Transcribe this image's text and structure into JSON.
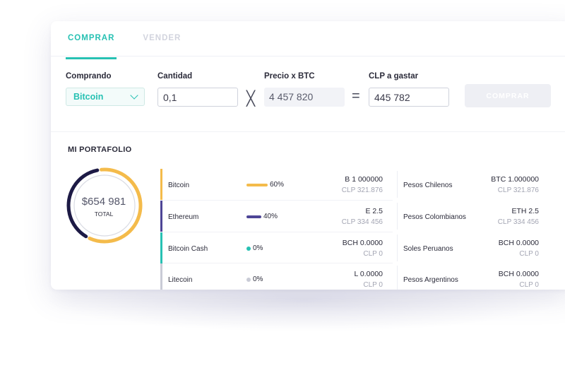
{
  "colors": {
    "accent": "#27c1b3",
    "bitcoin": "#f4bb4b",
    "ethereum": "#4d4596",
    "bitcoin_cash": "#27c1b3",
    "litecoin": "#c9cbd6",
    "donut_dark": "#1d1a45"
  },
  "tabs": [
    {
      "label": "COMPRAR",
      "active": true
    },
    {
      "label": "VENDER",
      "active": false
    }
  ],
  "form": {
    "comprando_label": "Comprando",
    "currency_selected": "Bitcoin",
    "cantidad_label": "Cantidad",
    "cantidad_value": "0,1",
    "precio_label": "Precio x BTC",
    "precio_value": "4 457 820",
    "times_symbol": "╳",
    "equals_symbol": "=",
    "gastar_label": "CLP a gastar",
    "gastar_value": "445 782",
    "buy_button": "COMPRAR"
  },
  "portfolio": {
    "title": "MI PORTAFOLIO",
    "total": "$654 981",
    "total_label": "TOTAL",
    "holdings": [
      {
        "name": "Bitcoin",
        "percent": 60,
        "percent_label": "60%",
        "amount": "B 1 000000",
        "clp": "CLP 321.876",
        "color": "#f4bb4b"
      },
      {
        "name": "Ethereum",
        "percent": 40,
        "percent_label": "40%",
        "amount": "E 2.5",
        "clp": "CLP 334 456",
        "color": "#4d4596"
      },
      {
        "name": "Bitcoin Cash",
        "percent": 0,
        "percent_label": "0%",
        "amount": "BCH 0.0000",
        "clp": "CLP 0",
        "color": "#27c1b3"
      },
      {
        "name": "Litecoin",
        "percent": 0,
        "percent_label": "0%",
        "amount": "L 0.0000",
        "clp": "CLP 0",
        "color": "#c9cbd6"
      }
    ],
    "fiat": [
      {
        "name": "Pesos Chilenos",
        "amount": "BTC 1.000000",
        "clp": "CLP 321.876"
      },
      {
        "name": "Pesos Colombianos",
        "amount": "ETH 2.5",
        "clp": "CLP 334 456"
      },
      {
        "name": "Soles Peruanos",
        "amount": "BCH 0.0000",
        "clp": "CLP 0"
      },
      {
        "name": "Pesos Argentinos",
        "amount": "BCH 0.0000",
        "clp": "CLP 0"
      }
    ]
  }
}
